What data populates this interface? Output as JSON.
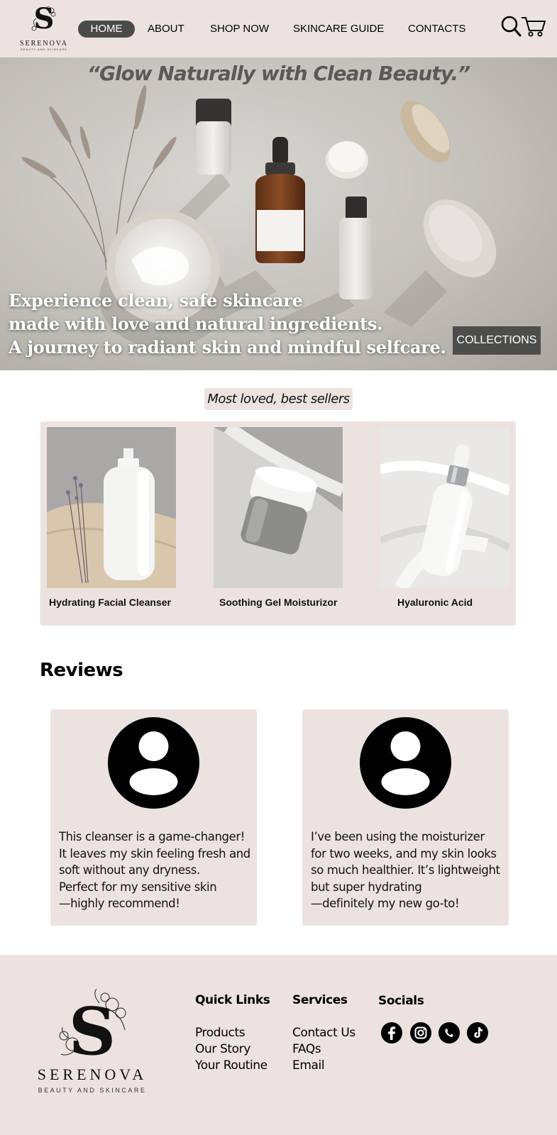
{
  "brand": {
    "name": "SERENOVA",
    "tagline": "BEAUTY AND SKINCARE"
  },
  "nav": {
    "items": [
      {
        "label": "HOME",
        "active": true
      },
      {
        "label": "ABOUT",
        "active": false
      },
      {
        "label": "SHOP NOW",
        "active": false
      },
      {
        "label": "SKINCARE GUIDE",
        "active": false
      },
      {
        "label": "CONTACTS",
        "active": false
      }
    ],
    "icons": [
      "search-icon",
      "cart-icon"
    ]
  },
  "hero": {
    "quote": "“Glow Naturally with Clean Beauty.”",
    "lines": [
      "Experience clean, safe skincare",
      "made with love and natural ingredients.",
      "A journey to radiant skin and mindful selfcare."
    ],
    "cta_label": "COLLECTIONS"
  },
  "bestsellers": {
    "title": "Most loved, best sellers",
    "products": [
      {
        "name": "Hydrating Facial Cleanser"
      },
      {
        "name": "Soothing Gel Moisturizor"
      },
      {
        "name": "Hyaluronic Acid"
      }
    ]
  },
  "reviews": {
    "title": "Reviews",
    "items": [
      {
        "lines": [
          "This cleanser is a game-changer!",
          "It leaves my skin feeling fresh and",
          "soft without any dryness.",
          "Perfect for my sensitive skin",
          "—highly recommend!"
        ]
      },
      {
        "lines": [
          "I’ve been using the moisturizer",
          "for two weeks, and my skin looks",
          "so much healthier. It’s lightweight",
          "but super hydrating",
          "—definitely my new go-to!"
        ]
      }
    ]
  },
  "footer": {
    "quick_links": {
      "title": "Quick Links",
      "items": [
        "Products",
        "Our Story",
        "Your Routine"
      ]
    },
    "services": {
      "title": "Services",
      "items": [
        "Contact Us",
        "FAQs",
        "Email"
      ]
    },
    "socials": {
      "title": "Socials",
      "icons": [
        "facebook-icon",
        "instagram-icon",
        "whatsapp-icon",
        "tiktok-icon"
      ]
    }
  },
  "colors": {
    "accent_bg": "#ece3e0",
    "nav_active": "#4a4a4a",
    "cta_bg": "#4d4d4b"
  }
}
